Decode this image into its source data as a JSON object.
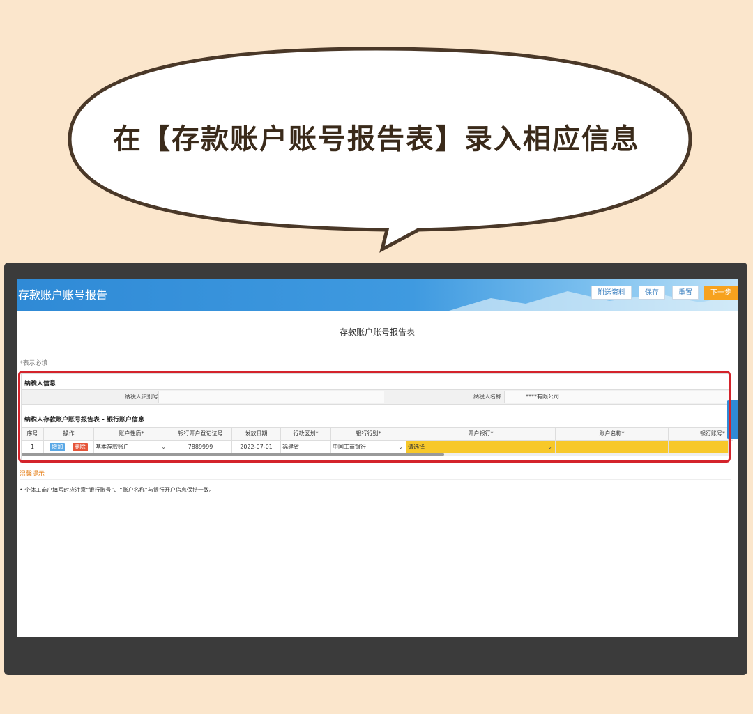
{
  "bubble": {
    "text": "在【存款账户账号报告表】录入相应信息"
  },
  "header": {
    "title": "存款账户账号报告",
    "buttons": {
      "attach": "附送资料",
      "save": "保存",
      "reset": "重置",
      "next": "下一步"
    }
  },
  "form": {
    "title": "存款账户账号报告表",
    "required_note": "*表示必填",
    "taxpayer_section": "纳税人信息",
    "taxpayer_id_label": "纳税人识别号",
    "taxpayer_id_value": "",
    "taxpayer_name_label": "纳税人名称",
    "taxpayer_name_value": "****有限公司",
    "bank_section": "纳税人存款账户账号报告表 - 银行账户信息",
    "columns": [
      "序号",
      "操作",
      "账户性质*",
      "银行开户登记证号",
      "发放日期",
      "行政区划*",
      "银行行别*",
      "开户银行*",
      "账户名称*",
      "银行账号*"
    ],
    "row": {
      "index": "1",
      "add": "增加",
      "delete": "删除",
      "account_type": "基本存款账户",
      "license_no": "7889999",
      "issue_date": "2022-07-01",
      "region": "福建省",
      "bank_type": "中国工商银行",
      "open_bank": "请选择"
    }
  },
  "tips": {
    "title": "温馨提示",
    "text": "• 个体工商户填写时应注意“银行账号”、“账户名称”与银行开户信息保持一致。"
  },
  "colors": {
    "accent": "#2f8ad6",
    "highlight": "#d4232b",
    "required_field": "#f7c82a",
    "next_button": "#f7a21e"
  }
}
